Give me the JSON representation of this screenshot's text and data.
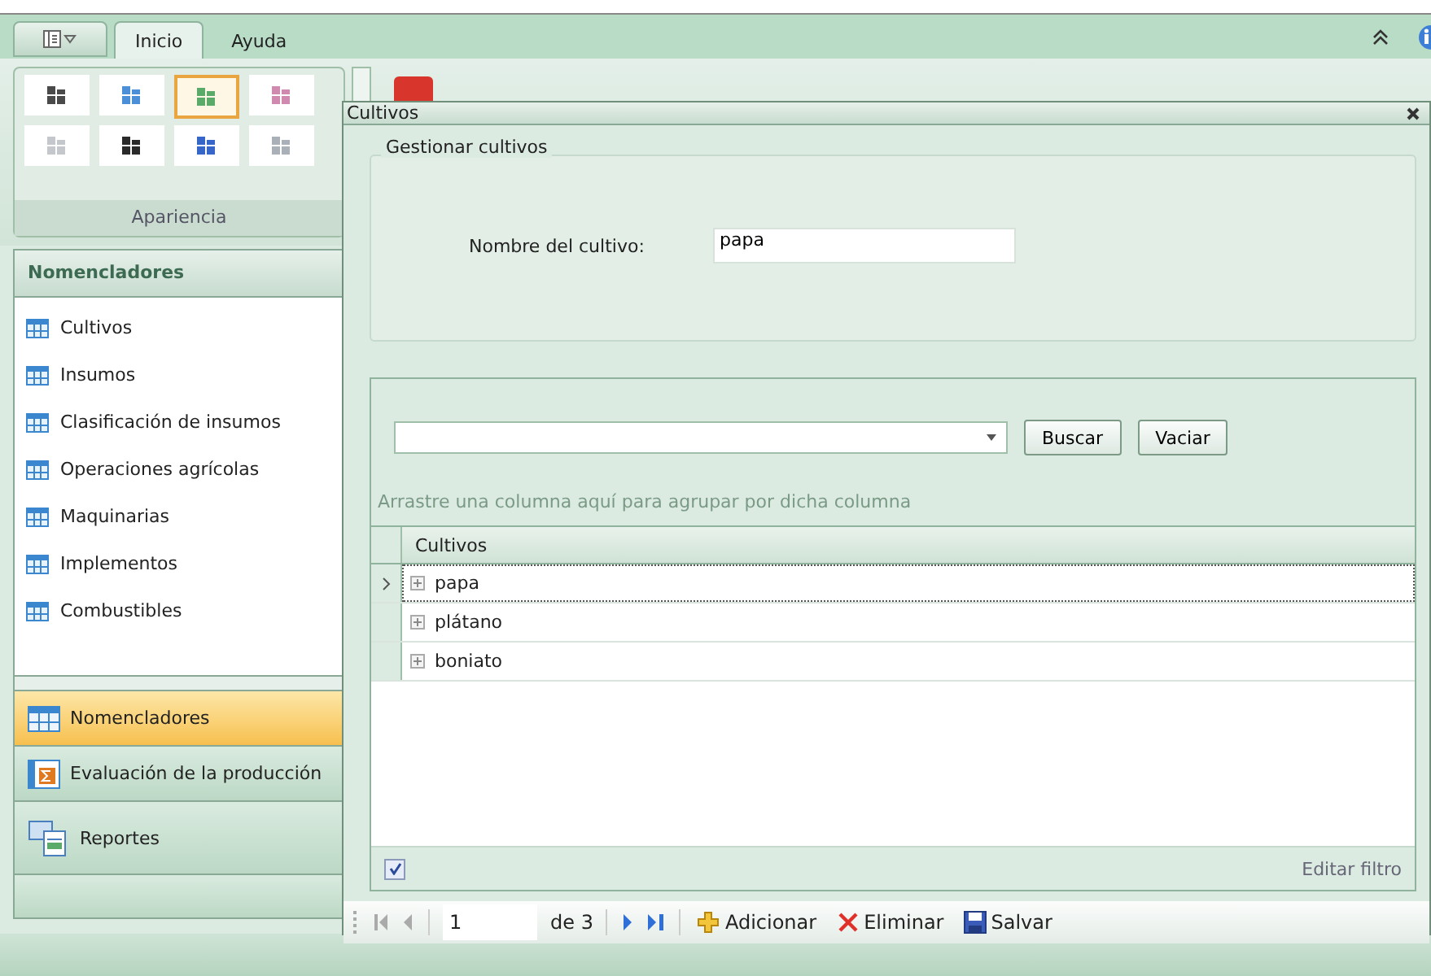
{
  "ribbon": {
    "tabs": [
      {
        "label": "Inicio",
        "selected": true
      },
      {
        "label": "Ayuda",
        "selected": false
      }
    ],
    "gallery": {
      "title": "Apariencia",
      "swatches": [
        {
          "color": "#4a4a4a",
          "selected": false
        },
        {
          "color": "#4a8fd8",
          "selected": false
        },
        {
          "color": "#5aaa6a",
          "selected": true
        },
        {
          "color": "#d08ab0",
          "selected": false
        },
        {
          "color": "#c4c8cc",
          "selected": false
        },
        {
          "color": "#2a2a2a",
          "selected": false
        },
        {
          "color": "#3566c8",
          "selected": false
        },
        {
          "color": "#aab0b8",
          "selected": false
        }
      ]
    }
  },
  "sidebar": {
    "title": "Nomencladores",
    "items": [
      {
        "label": "Cultivos"
      },
      {
        "label": "Insumos"
      },
      {
        "label": "Clasificación de insumos"
      },
      {
        "label": "Operaciones agrícolas"
      },
      {
        "label": "Maquinarias"
      },
      {
        "label": "Implementos"
      },
      {
        "label": "Combustibles"
      }
    ],
    "groups": [
      {
        "label": "Nomencladores",
        "kind": "table",
        "selected": true
      },
      {
        "label": "Evaluación de la producción",
        "kind": "sum",
        "selected": false
      },
      {
        "label": "Reportes",
        "kind": "report",
        "selected": false
      }
    ]
  },
  "dialog": {
    "title": "Cultivos",
    "group_title": "Gestionar cultivos",
    "field_label": "Nombre del cultivo:",
    "field_value": "papa",
    "buttons": [
      "Buscar",
      "Vaciar"
    ],
    "group_hint": "Arrastre una columna aquí para agrupar por dicha columna",
    "table": {
      "columns": [
        "Cultivos"
      ],
      "rows": [
        {
          "cells": [
            "papa"
          ],
          "selected": true
        },
        {
          "cells": [
            "plátano"
          ],
          "selected": false
        },
        {
          "cells": [
            "boniato"
          ],
          "selected": false
        }
      ]
    },
    "filter": {
      "checked": true,
      "label": "Editar filtro"
    },
    "pager": {
      "page": "1",
      "of": "de 3",
      "actions": [
        {
          "label": "Adicionar",
          "kind": "add"
        },
        {
          "label": "Eliminar",
          "kind": "delete"
        },
        {
          "label": "Salvar",
          "kind": "save"
        }
      ]
    }
  }
}
